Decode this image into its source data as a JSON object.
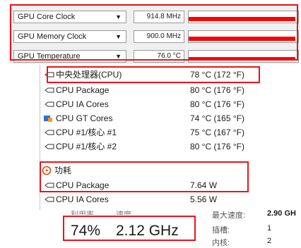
{
  "gpuz": {
    "sensors": [
      {
        "label": "GPU Core Clock",
        "value": "914.8 MHz"
      },
      {
        "label": "GPU Memory Clock",
        "value": "900.0 MHz"
      },
      {
        "label": "GPU Temperature",
        "value": "76.0 °C"
      }
    ]
  },
  "tree": {
    "cpu_group": {
      "label": "中央处理器(CPU)",
      "value": "78 °C  (172 °F)"
    },
    "cpu_rows": [
      {
        "label": "CPU Package",
        "value": "80 °C  (176 °F)"
      },
      {
        "label": "CPU IA Cores",
        "value": "80 °C  (176 °F)"
      },
      {
        "label": "CPU GT Cores",
        "value": "74 °C  (165 °F)"
      },
      {
        "label": "CPU #1/核心 #1",
        "value": "75 °C  (167 °F)"
      },
      {
        "label": "CPU #1/核心 #2",
        "value": "80 °C  (176 °F)"
      }
    ],
    "power_group": {
      "label": "功耗"
    },
    "power_rows": [
      {
        "label": "CPU Package",
        "value": "7.64 W"
      },
      {
        "label": "CPU IA Cores",
        "value": "5.56 W"
      }
    ]
  },
  "taskmanager": {
    "utilization_label": "利用率",
    "speed_label": "速度",
    "utilization": "74%",
    "speed": "2.12 GHz",
    "max_speed_label": "最大速度:",
    "max_speed": "2.90 GH",
    "sockets_label": "插槽:",
    "sockets": "1",
    "cores_label": "内核:",
    "cores": "2"
  },
  "colors": {
    "highlight": "#e8141c",
    "graph_bar": "#ff0000",
    "gt_icon_blue": "#2f6fd6",
    "power_icon": "#d4500a"
  },
  "icons": {
    "sensor_link": "sensor-link-icon",
    "gt_cores": "gpu-core-icon",
    "power": "power-icon",
    "dropdown": "chevron-down-icon"
  }
}
